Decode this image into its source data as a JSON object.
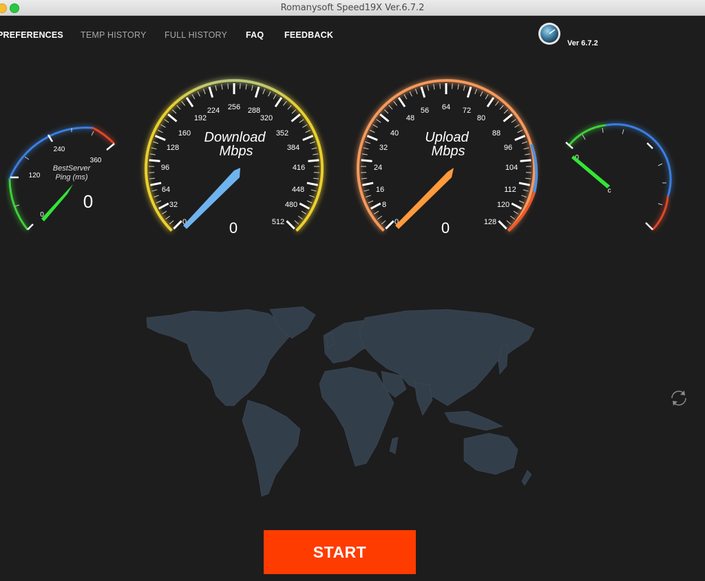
{
  "window": {
    "title": "Romanysoft Speed19X Ver.6.7.2"
  },
  "nav": {
    "preferences": "PREFERENCES",
    "temp_history": "TEMP HISTORY",
    "full_history": "FULL HISTORY",
    "faq": "FAQ",
    "feedback": "FEEDBACK"
  },
  "version": "Ver 6.7.2",
  "ping_gauge": {
    "label_line1": "BestServer",
    "label_line2": "Ping (ms)",
    "value": "0",
    "ticks": [
      "0",
      "120",
      "240",
      "360"
    ]
  },
  "download_gauge": {
    "label_line1": "Download",
    "label_line2": "Mbps",
    "value": "0",
    "ticks": [
      "0",
      "32",
      "64",
      "96",
      "128",
      "160",
      "192",
      "224",
      "256",
      "288",
      "320",
      "352",
      "384",
      "416",
      "448",
      "480",
      "512"
    ]
  },
  "upload_gauge": {
    "label_line1": "Upload",
    "label_line2": "Mbps",
    "value": "0",
    "ticks": [
      "0",
      "8",
      "16",
      "24",
      "32",
      "40",
      "48",
      "56",
      "64",
      "72",
      "80",
      "88",
      "96",
      "104",
      "112",
      "120",
      "128"
    ]
  },
  "extra_gauge": {
    "ticks": [
      "0"
    ],
    "center_label": "c"
  },
  "start_button": "START",
  "colors": {
    "start": "#ff3c00",
    "download_needle": "#6fb4ef",
    "upload_needle": "#ff9a3c",
    "ping_needle": "#31e636",
    "map": "#333e4b"
  }
}
